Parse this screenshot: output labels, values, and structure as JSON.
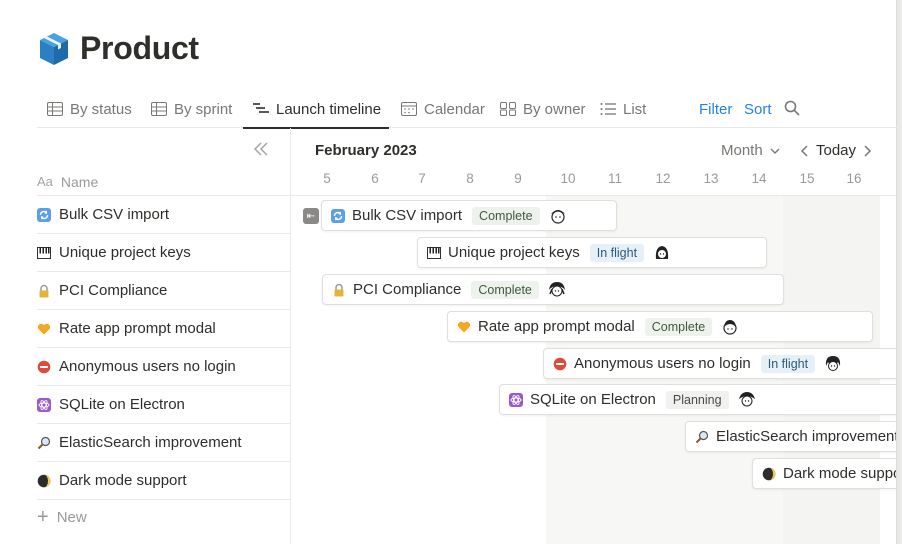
{
  "page": {
    "title": "Product",
    "icon": "package-cube-icon"
  },
  "tabs": [
    {
      "label": "By status",
      "icon": "table-icon"
    },
    {
      "label": "By sprint",
      "icon": "table-icon"
    },
    {
      "label": "Launch timeline",
      "icon": "timeline-icon",
      "active": true
    },
    {
      "label": "Calendar",
      "icon": "calendar-icon"
    },
    {
      "label": "By owner",
      "icon": "board-icon"
    },
    {
      "label": "List",
      "icon": "list-icon"
    }
  ],
  "actions": {
    "filter": "Filter",
    "sort": "Sort"
  },
  "table": {
    "name_type": "Aa",
    "name_header": "Name",
    "new_label": "New",
    "rows": [
      {
        "label": "Bulk CSV import",
        "icon": "sync-arrows-icon"
      },
      {
        "label": "Unique project keys",
        "icon": "piano-keys-icon"
      },
      {
        "label": "PCI Compliance",
        "icon": "lock-icon"
      },
      {
        "label": "Rate app prompt modal",
        "icon": "orange-heart-icon"
      },
      {
        "label": "Anonymous users no login",
        "icon": "no-entry-icon"
      },
      {
        "label": "SQLite on Electron",
        "icon": "atom-icon"
      },
      {
        "label": "ElasticSearch improvement",
        "icon": "magnifier-icon"
      },
      {
        "label": "Dark mode support",
        "icon": "moon-icon"
      }
    ]
  },
  "timeline": {
    "month": "February 2023",
    "scale": "Month",
    "today": "Today",
    "days": [
      "5",
      "6",
      "7",
      "8",
      "9",
      "10",
      "11",
      "12",
      "13",
      "14",
      "15",
      "16"
    ],
    "bars": [
      {
        "label": "Bulk CSV import",
        "status": "Complete",
        "icon": "sync-arrows-icon"
      },
      {
        "label": "Unique project keys",
        "status": "In flight",
        "icon": "piano-keys-icon"
      },
      {
        "label": "PCI Compliance",
        "status": "Complete",
        "icon": "lock-icon"
      },
      {
        "label": "Rate app prompt modal",
        "status": "Complete",
        "icon": "orange-heart-icon"
      },
      {
        "label": "Anonymous users no login",
        "status": "In flight",
        "icon": "no-entry-icon"
      },
      {
        "label": "SQLite on Electron",
        "status": "Planning",
        "icon": "atom-icon"
      },
      {
        "label": "ElasticSearch improvement",
        "status": "",
        "icon": "magnifier-icon"
      },
      {
        "label": "Dark mode support",
        "status": "",
        "icon": "moon-icon"
      }
    ]
  },
  "colors": {
    "accent": "#2383e2",
    "complete_bg": "#edf3ec",
    "inflight_bg": "#e7f0f7",
    "planning_bg": "#f1f1ef",
    "weekend_bg": "#f7f7f5"
  }
}
